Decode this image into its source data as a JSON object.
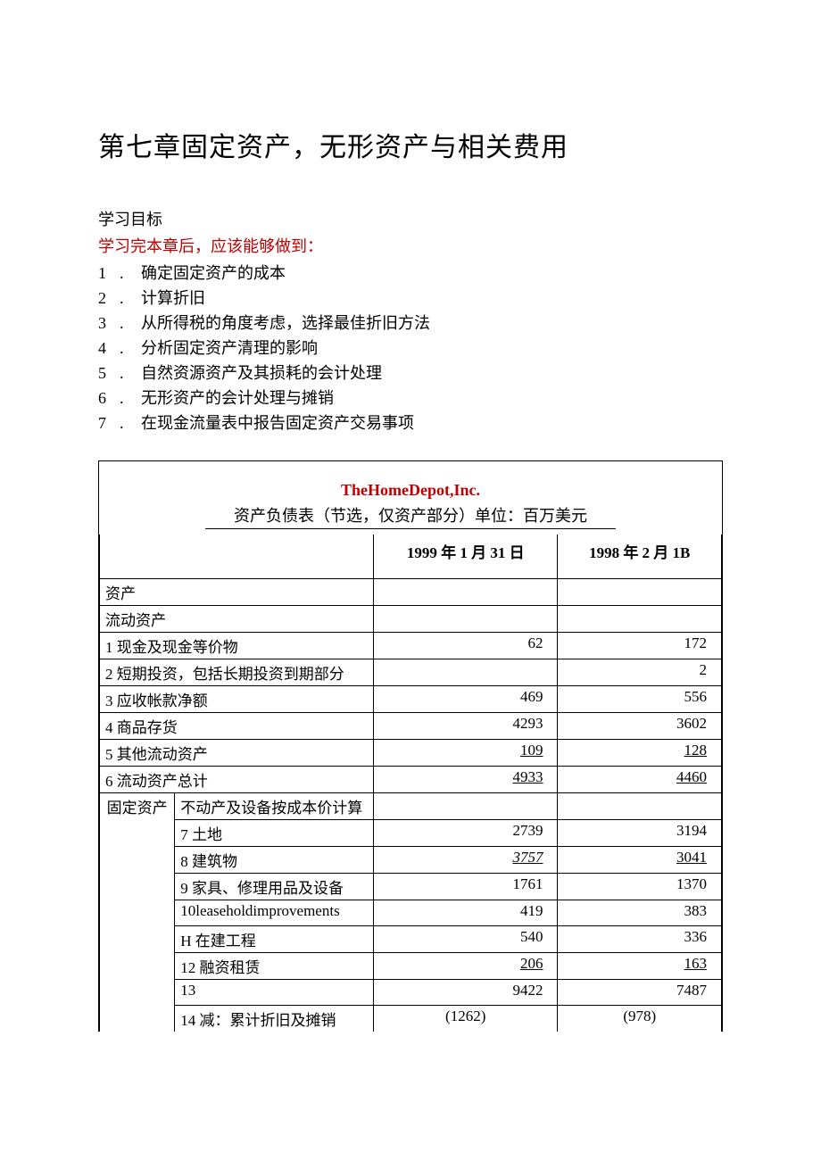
{
  "title": "第七章固定资产，无形资产与相关费用",
  "subhead": "学习目标",
  "subhead_red": "学习完本章后，应该能够做到：",
  "objectives": [
    {
      "n": "1",
      "dot": ".",
      "text": "确定固定资产的成本"
    },
    {
      "n": "2",
      "dot": ".",
      "text": "计算折旧"
    },
    {
      "n": "3",
      "dot": ".",
      "text": "从所得税的角度考虑，选择最佳折旧方法"
    },
    {
      "n": "4",
      "dot": ".",
      "text": "分析固定资产清理的影响"
    },
    {
      "n": "5",
      "dot": ".",
      "text": "自然资源资产及其损耗的会计处理"
    },
    {
      "n": "6",
      "dot": ".",
      "text": "无形资产的会计处理与摊销"
    },
    {
      "n": "7",
      "dot": ".",
      "text": "在现金流量表中报告固定资产交易事项"
    }
  ],
  "company": "TheHomeDepot,Inc.",
  "sheet_sub": "资产负债表（节选，仅资产部分）单位：百万美元",
  "header": {
    "col1": "1999 年 1 月 31 日",
    "col2": "1998 年 2 月 1B"
  },
  "rows": {
    "assets": "资产",
    "current_assets": "流动资产",
    "r1": {
      "label": "1 现金及现金等价物",
      "v1": "62",
      "v2": "172"
    },
    "r2": {
      "label": "2 短期投资，包括长期投资到期部分",
      "v1": "",
      "v2": "2"
    },
    "r3": {
      "label": "3 应收帐款净额",
      "v1": "469",
      "v2": "556"
    },
    "r4": {
      "label": "4 商品存货",
      "v1": "4293",
      "v2": "3602"
    },
    "r5": {
      "label": "5 其他流动资产",
      "v1": "109",
      "v2": "128"
    },
    "r6": {
      "label": "6 流动资产总计",
      "v1": "4933",
      "v2": "4460"
    },
    "fixed_head": {
      "a": "固定资产",
      "b": "不动产及设备按成本价计算"
    },
    "r7": {
      "label": "7 土地",
      "v1": "2739",
      "v2": "3194"
    },
    "r8": {
      "label": "8 建筑物",
      "v1": "3757",
      "v2": "3041"
    },
    "r9": {
      "label": "9 家具、修理用品及设备",
      "v1": "1761",
      "v2": "1370"
    },
    "r10": {
      "label": "10leaseholdimprovements",
      "v1": "419",
      "v2": "383"
    },
    "r11": {
      "label": "H 在建工程",
      "v1": "540",
      "v2": "336"
    },
    "r12": {
      "label": "12 融资租赁",
      "v1": "206",
      "v2": "163"
    },
    "r13": {
      "label": "13",
      "v1": "9422",
      "v2": "7487"
    },
    "r14": {
      "label": "14 减：累计折旧及摊销",
      "v1": "(1262)",
      "v2": "(978)"
    }
  }
}
